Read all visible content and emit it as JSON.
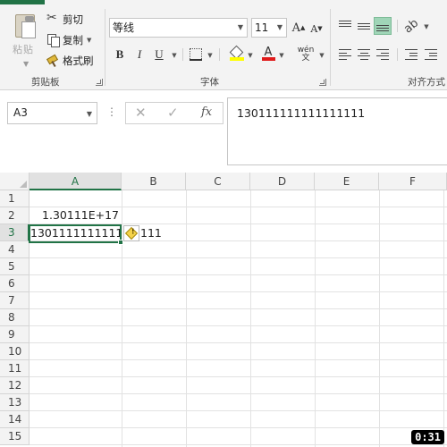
{
  "ribbon": {
    "clipboard": {
      "paste_label": "粘贴",
      "cut_label": "剪切",
      "copy_label": "复制",
      "format_painter_label": "格式刷",
      "group_label": "剪贴板"
    },
    "font": {
      "font_name": "等线",
      "font_size": "11",
      "grow_label": "A",
      "shrink_label": "A",
      "bold_label": "B",
      "italic_label": "I",
      "underline_label": "U",
      "font_color_label": "A",
      "phonetic_top": "wén",
      "phonetic_bottom": "文",
      "group_label": "字体",
      "fill_color": "#ffff00",
      "font_color": "#e01b1b"
    },
    "alignment": {
      "group_label": "对齐方式",
      "active_color": "#9fd5b7"
    }
  },
  "formula_bar": {
    "name_box": "A3",
    "fx_label": "fx",
    "content": "130111111111111111"
  },
  "grid": {
    "columns": [
      "A",
      "B",
      "C",
      "D",
      "E",
      "F"
    ],
    "rows": [
      "1",
      "2",
      "3",
      "4",
      "5",
      "6",
      "7",
      "8",
      "9",
      "10",
      "11",
      "12",
      "13",
      "14",
      "15"
    ],
    "selected_column": "A",
    "selected_row": "3",
    "cells": {
      "A2": "1.30111E+17",
      "A3": "130111111111111111"
    },
    "overflow_visible": "111",
    "accent_color": "#217346"
  },
  "overlay": {
    "timer": "0:31"
  }
}
